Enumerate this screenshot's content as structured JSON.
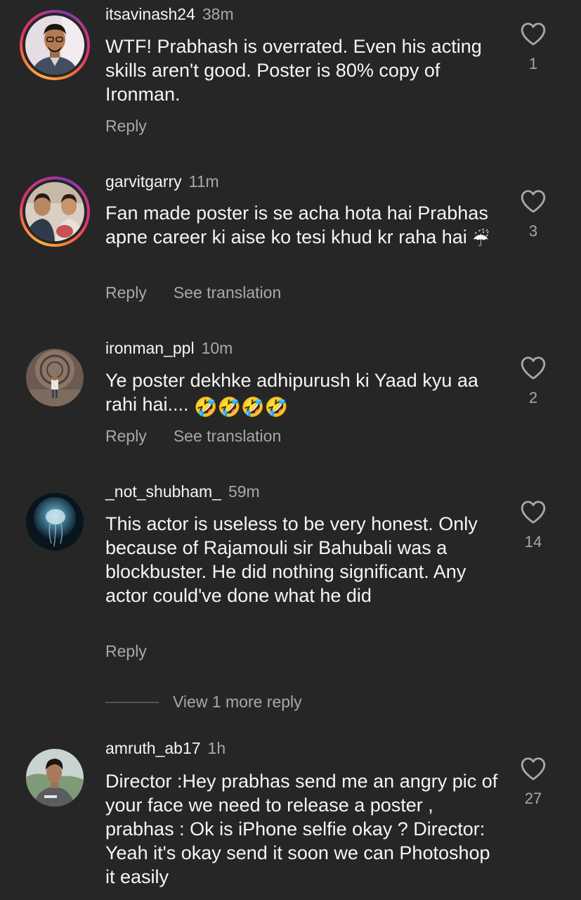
{
  "comments": [
    {
      "username": "itsavinash24",
      "time": "38m",
      "text": "WTF! Prabhash is overrated. Even his acting skills aren't good. Poster is 80% copy of Ironman.",
      "reply": "Reply",
      "likes": "1",
      "has_story_ring": true
    },
    {
      "username": "garvitgarry",
      "time": "11m",
      "text": "Fan made poster is se acha hota hai Prabhas apne career ki aise ko tesi khud kr raha hai",
      "emoji": "☔",
      "reply": "Reply",
      "translate": "See translation",
      "likes": "3",
      "has_story_ring": true
    },
    {
      "username": "ironman_ppl",
      "time": "10m",
      "text": "Ye poster dekhke adhipurush ki Yaad kyu aa rahi hai....",
      "emoji": "🤣🤣🤣🤣",
      "reply": "Reply",
      "translate": "See translation",
      "likes": "2",
      "has_story_ring": false
    },
    {
      "username": "_not_shubham_",
      "time": "59m",
      "text": "This actor is useless to be very honest. Only because of Rajamouli sir Bahubali was a blockbuster. He did nothing significant. Any actor could've done what he did",
      "reply": "Reply",
      "likes": "14",
      "has_story_ring": false
    },
    {
      "username": "amruth_ab17",
      "time": "1h",
      "text": "Director :Hey prabhas send me an angry pic of your face we need to release a poster , prabhas : Ok is iPhone selfie okay ? Director: Yeah it's okay send it soon we can Photoshop it easily",
      "likes": "27",
      "has_story_ring": false
    }
  ],
  "view_more_replies": "View 1 more reply",
  "colors": {
    "background": "#262626",
    "primary_text": "#f5f5f5",
    "secondary_text": "#a8a8a8"
  },
  "icons": {
    "like": "heart-outline-icon"
  }
}
